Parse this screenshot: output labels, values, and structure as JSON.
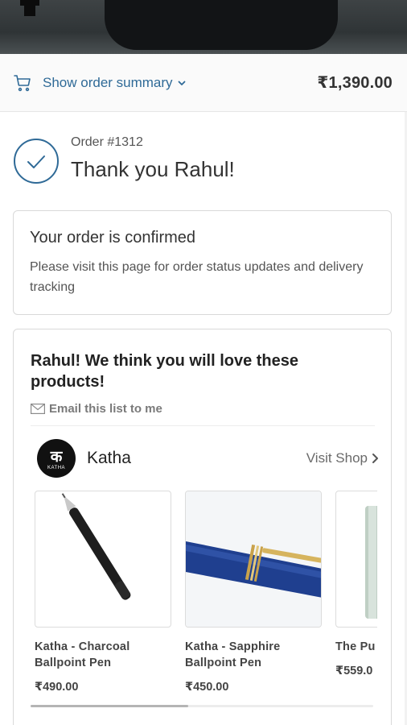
{
  "summary": {
    "toggle_label": "Show order summary",
    "total": "₹1,390.00"
  },
  "order": {
    "number": "Order #1312",
    "thanks": "Thank you Rahul!"
  },
  "confirmation": {
    "title": "Your order is confirmed",
    "description": "Please visit this page for order status updates and delivery tracking"
  },
  "recommendations": {
    "heading": "Rahul! We think you will love these products!",
    "email_link": "Email this list to me",
    "shop": {
      "name": "Katha",
      "logo_glyph": "क",
      "logo_brand": "KATHA",
      "visit_label": "Visit Shop"
    },
    "products": [
      {
        "name": "Katha - Charcoal Ballpoint Pen",
        "price": "₹490.00"
      },
      {
        "name": "Katha - Sapphire Ballpoint Pen",
        "price": "₹450.00"
      },
      {
        "name": "The Pu",
        "price": "₹559.0"
      }
    ],
    "carousel_scroll_fraction": 0.46
  },
  "colors": {
    "accent": "#2f6a97",
    "border": "#d9d9d9"
  },
  "icons": [
    "cart-icon",
    "chevron-down-icon",
    "check-circle-icon",
    "mail-icon",
    "chevron-right-icon"
  ]
}
